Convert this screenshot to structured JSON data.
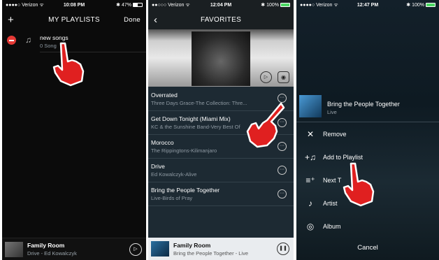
{
  "phone1": {
    "status": {
      "carrier": "●●●●○ Verizon ᯤ",
      "time": "10:08 PM",
      "battery": "47%",
      "bt": "✱"
    },
    "nav": {
      "left": "+",
      "title": "MY PLAYLISTS",
      "right": "Done"
    },
    "playlist": {
      "name": "new songs",
      "count": "0 Song"
    },
    "mini": {
      "title": "Family Room",
      "subtitle": "Drive - Ed Kowalczyk"
    }
  },
  "phone2": {
    "status": {
      "carrier": "●●○○○ Verizon ᯤ",
      "time": "12:04 PM",
      "battery": "100%",
      "bt": "✱"
    },
    "nav": {
      "left": "‹",
      "title": "FAVORITES"
    },
    "songs": [
      {
        "title": "Overrated",
        "subtitle": "Three Days Grace-The Collection: Thre..."
      },
      {
        "title": "Get Down Tonight (Miami Mix)",
        "subtitle": "KC & the Sunshine Band-Very Best Of"
      },
      {
        "title": "Morocco",
        "subtitle": "The Rippingtons-Kilimanjaro"
      },
      {
        "title": "Drive",
        "subtitle": "Ed Kowalczyk-Alive"
      },
      {
        "title": "Bring the People Together",
        "subtitle": "Live-Birds of Pray"
      }
    ],
    "mini": {
      "title": "Family Room",
      "subtitle": "Bring the People Together - Live"
    }
  },
  "phone3": {
    "status": {
      "carrier": "●●●●○ Verizon ᯤ",
      "time": "12:47 PM",
      "battery": "100%",
      "bt": "✱"
    },
    "song": {
      "title": "Bring the People Together",
      "artist": "Live"
    },
    "menu": [
      {
        "icon": "close-icon",
        "label": "Remove"
      },
      {
        "icon": "add-to-playlist-icon",
        "label": "Add to Playlist"
      },
      {
        "icon": "next-track-icon",
        "label": "Next T"
      },
      {
        "icon": "artist-icon",
        "label": "Artist"
      },
      {
        "icon": "album-icon",
        "label": "Album"
      }
    ],
    "cancel": "Cancel"
  },
  "colors": {
    "hand": "#e02020",
    "battery_green": "#4cd964",
    "remove_red": "#e53935"
  }
}
